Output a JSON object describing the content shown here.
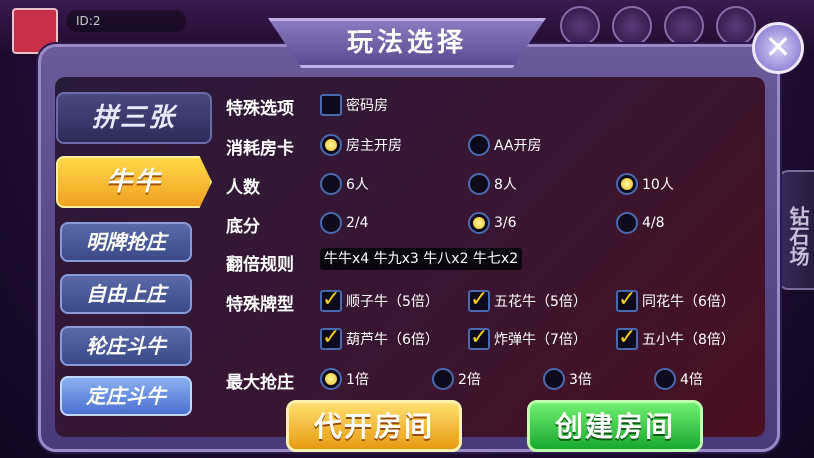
{
  "dialog": {
    "title": "玩法选择",
    "close_label": "✕"
  },
  "top": {
    "user_id": "ID:2"
  },
  "side_tab": {
    "label": "钻石场"
  },
  "modes": [
    {
      "label": "拼三张",
      "active": false
    },
    {
      "label": "牛牛",
      "active": true
    }
  ],
  "sub_modes": [
    {
      "label": "明牌抢庄",
      "active": false
    },
    {
      "label": "自由上庄",
      "active": false
    },
    {
      "label": "轮庄斗牛",
      "active": false
    },
    {
      "label": "定庄斗牛",
      "active": true
    }
  ],
  "options": {
    "special": {
      "label": "特殊选项",
      "items": [
        {
          "text": "密码房",
          "checked": false
        }
      ]
    },
    "cost": {
      "label": "消耗房卡",
      "items": [
        {
          "text": "房主开房",
          "selected": true
        },
        {
          "text": "AA开房",
          "selected": false
        }
      ]
    },
    "players": {
      "label": "人数",
      "items": [
        {
          "text": "6人",
          "selected": false
        },
        {
          "text": "8人",
          "selected": false
        },
        {
          "text": "10人",
          "selected": true
        }
      ]
    },
    "base": {
      "label": "底分",
      "items": [
        {
          "text": "2/4",
          "selected": false
        },
        {
          "text": "3/6",
          "selected": true
        },
        {
          "text": "4/8",
          "selected": false
        }
      ]
    },
    "multiplier": {
      "label": "翻倍规则",
      "value": "牛牛x4 牛九x3 牛八x2 牛七x2"
    },
    "special_cards": {
      "label": "特殊牌型",
      "items": [
        {
          "text": "顺子牛（5倍）",
          "checked": true
        },
        {
          "text": "五花牛（5倍）",
          "checked": true
        },
        {
          "text": "同花牛（6倍）",
          "checked": true
        },
        {
          "text": "葫芦牛（6倍）",
          "checked": true
        },
        {
          "text": "炸弹牛（7倍）",
          "checked": true
        },
        {
          "text": "五小牛（8倍）",
          "checked": true
        }
      ]
    },
    "max_grab": {
      "label": "最大抢庄",
      "items": [
        {
          "text": "1倍",
          "selected": true
        },
        {
          "text": "2倍",
          "selected": false
        },
        {
          "text": "3倍",
          "selected": false
        },
        {
          "text": "4倍",
          "selected": false
        }
      ]
    }
  },
  "buttons": {
    "proxy_open": "代开房间",
    "create": "创建房间"
  },
  "colors": {
    "accent_yellow": "#f0c020",
    "accent_green": "#18a830",
    "dialog_purple": "#5a4a90"
  }
}
